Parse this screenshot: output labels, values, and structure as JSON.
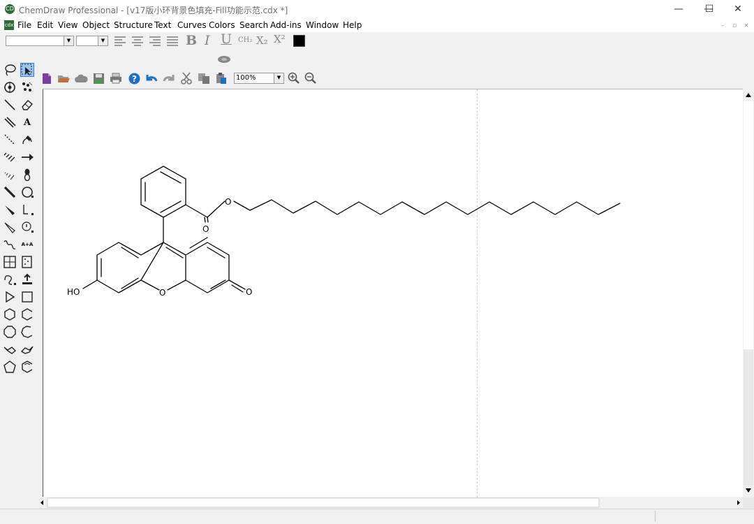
{
  "window": {
    "title": "ChemDraw Professional - [v17版小环背景色填充-Fill功能示范.cdx *]",
    "app_icon_glyph": "CD",
    "minimize_glyph": "—",
    "maximize_glyph": "☐",
    "close_glyph": "✕"
  },
  "menubar": {
    "doc_icon_glyph": "cdx",
    "items": [
      "File",
      "Edit",
      "View",
      "Object",
      "Structure",
      "Text",
      "Curves",
      "Colors",
      "Search",
      "Add-ins",
      "Window",
      "Help"
    ],
    "mdi_minimize": "–",
    "mdi_restore": "▫",
    "mdi_close": "×"
  },
  "format_toolbar": {
    "font_combo_value": "",
    "size_combo_value": "",
    "bold": "B",
    "italic": "I",
    "underline": "U",
    "formula": "CH₂",
    "subscript": "X₂",
    "superscript": "X²",
    "text_color": "#000000"
  },
  "main_toolbar": {
    "zoom_value": "100%"
  },
  "molecule": {
    "hydroxyl_label": "HO",
    "ester_oxygen_label": "O",
    "carbonyl_oxygen_label": "O",
    "ring_oxygen_label": "O",
    "ketone_oxygen_label": "O"
  },
  "colors": {
    "selection": "#9dc3f2",
    "accent_blue": "#1f6fc5",
    "canvas": "#ffffff"
  }
}
